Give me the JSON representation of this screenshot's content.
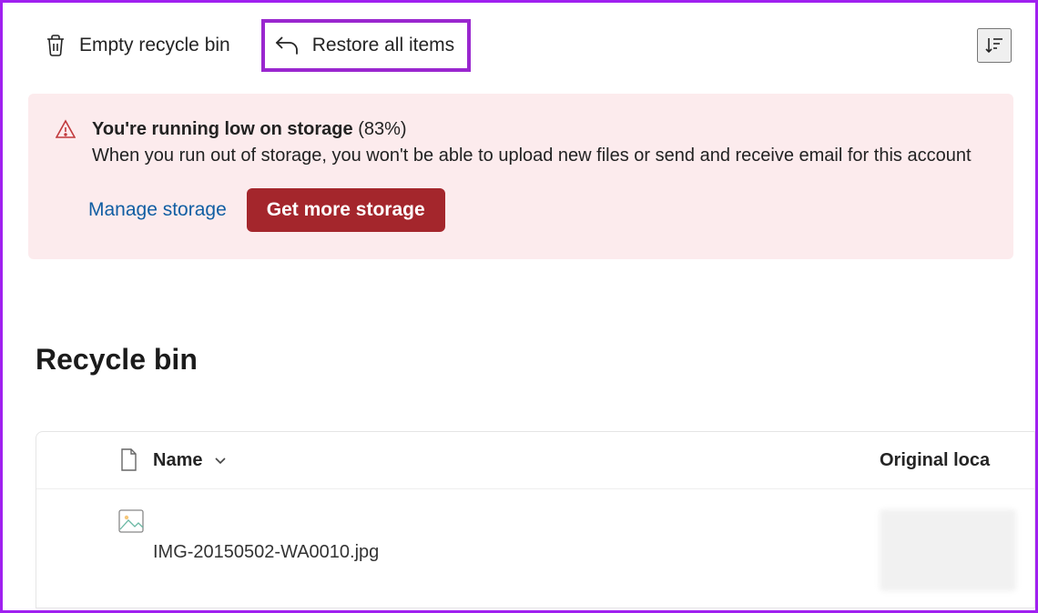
{
  "toolbar": {
    "empty_label": "Empty recycle bin",
    "restore_label": "Restore all items"
  },
  "banner": {
    "title_prefix": "You're running low on storage",
    "title_pct": "(83%)",
    "description": "When you run out of storage, you won't be able to upload new files or send and receive email for this account",
    "manage_label": "Manage storage",
    "get_more_label": "Get more storage"
  },
  "page": {
    "title": "Recycle bin"
  },
  "table": {
    "columns": {
      "name": "Name",
      "location": "Original loca"
    },
    "rows": [
      {
        "filename": "IMG-20150502-WA0010.jpg"
      }
    ]
  }
}
